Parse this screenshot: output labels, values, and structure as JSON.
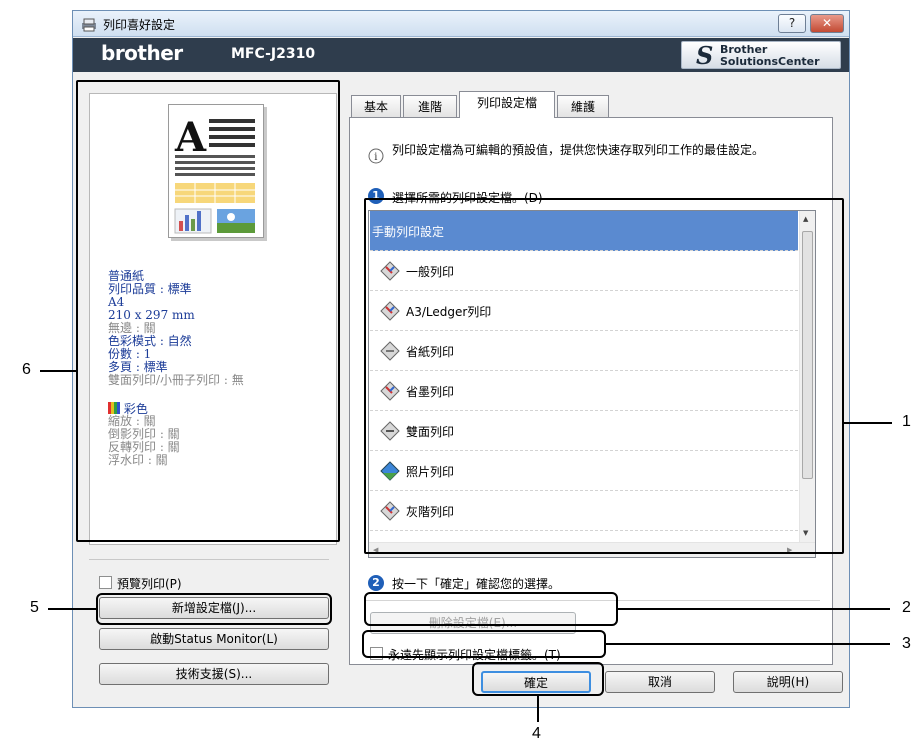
{
  "window": {
    "title": "列印喜好設定",
    "help_btn": "?",
    "close_btn": "✕"
  },
  "header": {
    "brand": "brother",
    "model": "MFC-J2310",
    "bsc_line1": "Brother",
    "bsc_line2": "SolutionsCenter"
  },
  "preview": {
    "settings": [
      {
        "text": "普通紙",
        "style": "blue"
      },
      {
        "text": "列印品質 : 標準",
        "style": "blue"
      },
      {
        "text": "A4",
        "style": "blue"
      },
      {
        "text": "210 x 297 mm",
        "style": "blue"
      },
      {
        "text": "無邊 : 關",
        "style": "grey"
      },
      {
        "text": "色彩模式 : 自然",
        "style": "blue"
      },
      {
        "text": "份數 : 1",
        "style": "blue"
      },
      {
        "text": "多頁 : 標準",
        "style": "blue"
      },
      {
        "text": "雙面列印/小冊子列印 : 無",
        "style": "grey"
      }
    ],
    "color_label": "彩色",
    "settings2": [
      {
        "text": "縮放 : 關",
        "style": "grey"
      },
      {
        "text": "倒影列印 : 關",
        "style": "grey"
      },
      {
        "text": "反轉列印 : 關",
        "style": "grey"
      },
      {
        "text": "浮水印 : 關",
        "style": "grey"
      }
    ]
  },
  "left_controls": {
    "preview_print": "預覽列印(P)",
    "add_profile": "新增設定檔(J)...",
    "status_monitor": "啟動Status Monitor(L)",
    "support": "技術支援(S)..."
  },
  "tabs": [
    "基本",
    "進階",
    "列印設定檔",
    "維護"
  ],
  "profiles_tab": {
    "info": "列印設定檔為可編輯的預設值，提供您快速存取列印工作的最佳設定。",
    "step1_num": "1",
    "step1": "選擇所需的列印設定檔。(D)",
    "items": [
      "手動列印設定",
      "一般列印",
      "A3/Ledger列印",
      "省紙列印",
      "省墨列印",
      "雙面列印",
      "照片列印",
      "灰階列印"
    ],
    "step2_num": "2",
    "step2": "按一下「確定」確認您的選擇。",
    "delete_btn": "刪除設定檔(E)...",
    "always_show": "永遠先顯示列印設定檔標籤。(T)"
  },
  "dialog_buttons": {
    "ok": "確定",
    "cancel": "取消",
    "help": "說明(H)"
  },
  "callouts": [
    "1",
    "2",
    "3",
    "4",
    "5",
    "6"
  ]
}
